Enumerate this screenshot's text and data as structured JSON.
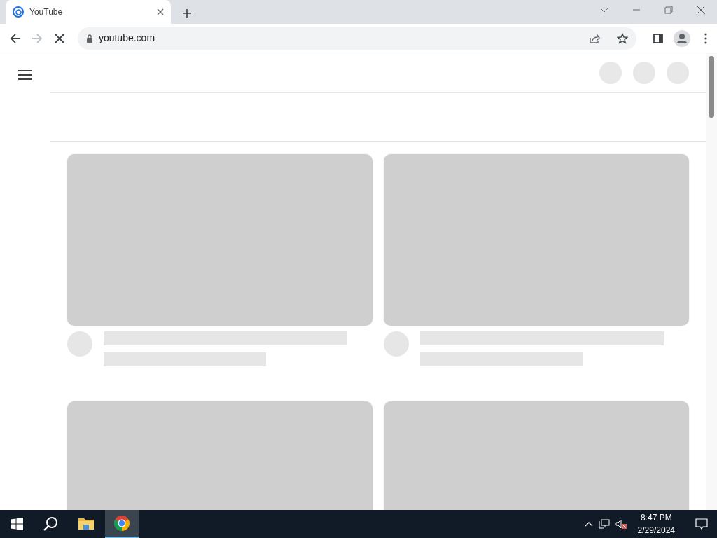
{
  "browser": {
    "tab": {
      "title": "YouTube",
      "selected": true
    },
    "address": "youtube.com",
    "page_loading": true,
    "back_enabled": true,
    "forward_enabled": false
  },
  "taskbar": {
    "apps": [
      {
        "kind": "search",
        "selected": false
      },
      {
        "kind": "files",
        "selected": false
      },
      {
        "kind": "browser",
        "selected": true
      }
    ],
    "muted": true,
    "time": "8:47 PM",
    "date": "2/29/2024"
  }
}
